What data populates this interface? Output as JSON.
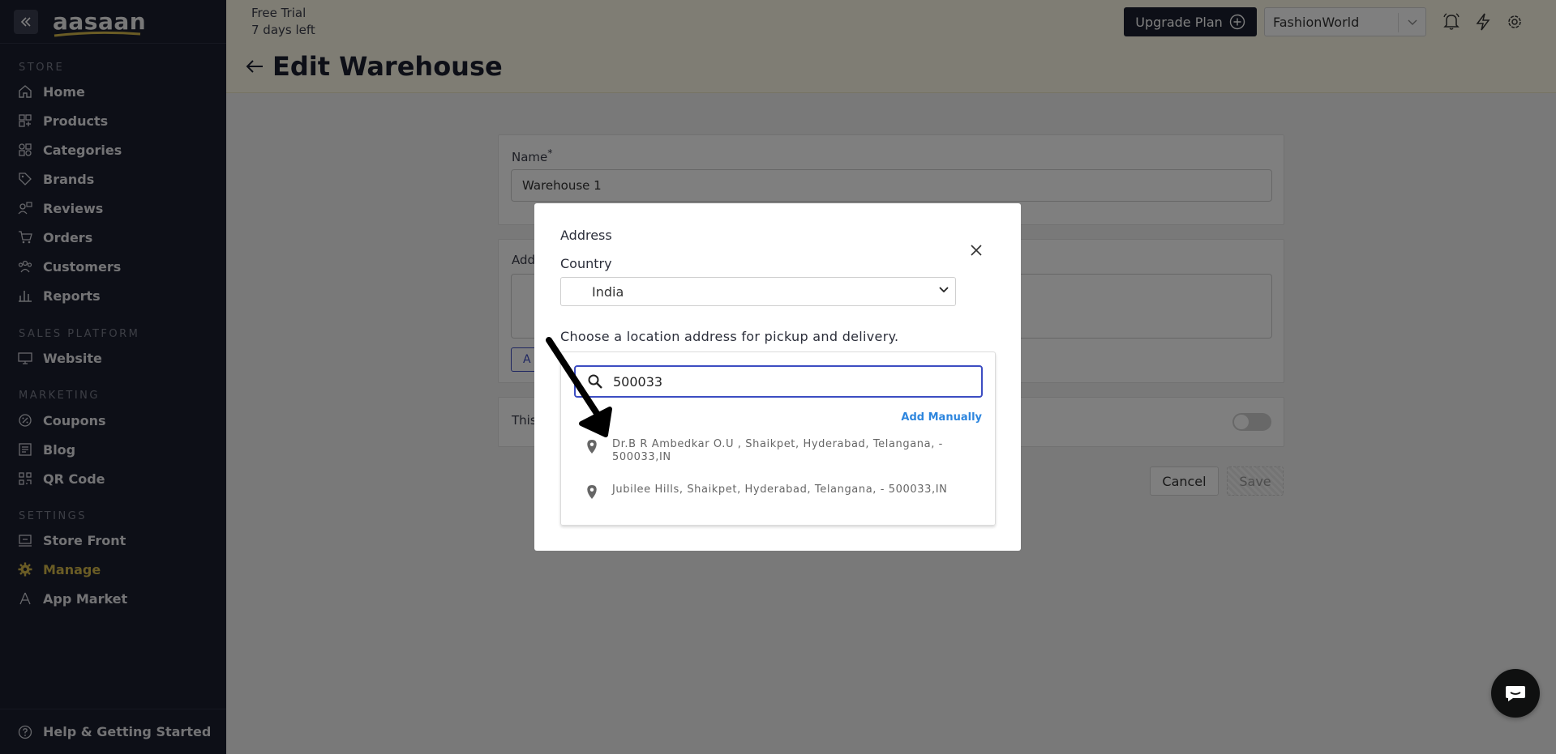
{
  "sidebar": {
    "logo": "aasaan",
    "sections": [
      "STORE",
      "SALES PLATFORM",
      "MARKETING",
      "SETTINGS"
    ],
    "items": [
      {
        "label": "Home",
        "icon": "home-icon"
      },
      {
        "label": "Products",
        "icon": "products-icon"
      },
      {
        "label": "Categories",
        "icon": "categories-icon"
      },
      {
        "label": "Brands",
        "icon": "tag-icon"
      },
      {
        "label": "Reviews",
        "icon": "reviews-icon"
      },
      {
        "label": "Orders",
        "icon": "cart-icon"
      },
      {
        "label": "Customers",
        "icon": "customers-icon"
      },
      {
        "label": "Reports",
        "icon": "reports-icon"
      },
      {
        "label": "Website",
        "icon": "monitor-icon"
      },
      {
        "label": "Coupons",
        "icon": "coupon-icon"
      },
      {
        "label": "Blog",
        "icon": "blog-icon"
      },
      {
        "label": "QR Code",
        "icon": "qrcode-icon"
      },
      {
        "label": "Store Front",
        "icon": "storefront-icon"
      },
      {
        "label": "Manage",
        "icon": "gear-icon",
        "active": true
      },
      {
        "label": "App Market",
        "icon": "app-market-icon"
      }
    ],
    "help": "Help & Getting Started"
  },
  "header": {
    "trial_line1": "Free Trial",
    "trial_line2": "7 days left",
    "upgrade_label": "Upgrade Plan",
    "store_name": "FashionWorld",
    "page_title": "Edit Warehouse"
  },
  "form": {
    "name_label": "Name",
    "name_required": "*",
    "name_value": "Warehouse 1",
    "address_label_partial": "Add",
    "add_button_partial": "A",
    "toggle_label_partial": "This",
    "cancel_label": "Cancel",
    "save_label": "Save"
  },
  "modal": {
    "title": "Address",
    "country_label": "Country",
    "country_value": "India",
    "description": "Choose a location address for pickup and delivery.",
    "search_value": "500033",
    "add_manually": "Add Manually",
    "results": [
      "Dr.B R Ambedkar O.U , Shaikpet, Hyderabad, Telangana, - 500033,IN",
      "Jubilee Hills, Shaikpet, Hyderabad, Telangana, - 500033,IN"
    ]
  },
  "colors": {
    "sidebar_bg": "#1b1e2e",
    "header_bg": "#fffbe8",
    "active_item": "#d4b84a",
    "search_border": "#3c4dc2",
    "link_blue": "#2e86de"
  }
}
